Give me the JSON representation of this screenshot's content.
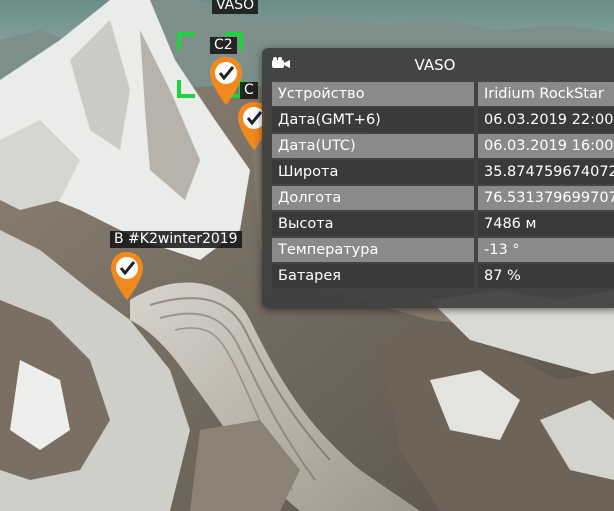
{
  "map": {
    "top_label": "VASO",
    "selected_marker": {
      "label": "C2"
    },
    "second_marker": {
      "label": "C"
    },
    "base_marker": {
      "label": "B #K2winter2019"
    }
  },
  "panel": {
    "icon": "camera-icon",
    "title": "VASO",
    "rows": [
      {
        "key": "Устройство",
        "value": "Iridium RockStar"
      },
      {
        "key": "Дата(GMT+6)",
        "value": "06.03.2019 22:00"
      },
      {
        "key": "Дата(UTC)",
        "value": "06.03.2019 16:00"
      },
      {
        "key": "Широта",
        "value": "35.874759674072"
      },
      {
        "key": "Долгота",
        "value": "76.531379699707"
      },
      {
        "key": "Высота",
        "value": "7486 м"
      },
      {
        "key": "Температура",
        "value": "-13 °"
      },
      {
        "key": "Батарея",
        "value": "87 %"
      }
    ]
  },
  "colors": {
    "marker": "#f08a1e",
    "selection": "#1ed43c",
    "panel_bg": "#3e3e3e",
    "row_light": "#8a8a8a",
    "row_dark": "#3a3a3a"
  }
}
